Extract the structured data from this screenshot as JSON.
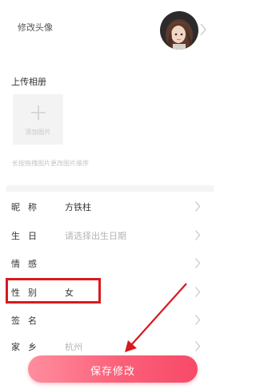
{
  "profile": {
    "avatar_label": "修改头像",
    "avatar_icon": "avatar-illustration"
  },
  "upload": {
    "title": "上传相册",
    "add_label": "添加图片",
    "hint": "长按拖拽图片更改图片顺序"
  },
  "fields": {
    "nickname": {
      "label": "昵称",
      "value": "方铁柱"
    },
    "birthday": {
      "label": "生日",
      "placeholder": "请选择出生日期"
    },
    "emotion": {
      "label": "情感",
      "value": ""
    },
    "gender": {
      "label": "性别",
      "value": "女"
    },
    "signature": {
      "label": "签名",
      "value": ""
    },
    "hometown": {
      "label": "家乡",
      "placeholder": "杭州"
    }
  },
  "actions": {
    "save_label": "保存修改"
  },
  "annotation": {
    "highlight_color": "#d61a1f",
    "arrow_color": "#d61a1f"
  },
  "colors": {
    "button_start": "#ff8e9e",
    "button_end": "#f74a68",
    "divider": "#f4f4f4"
  }
}
